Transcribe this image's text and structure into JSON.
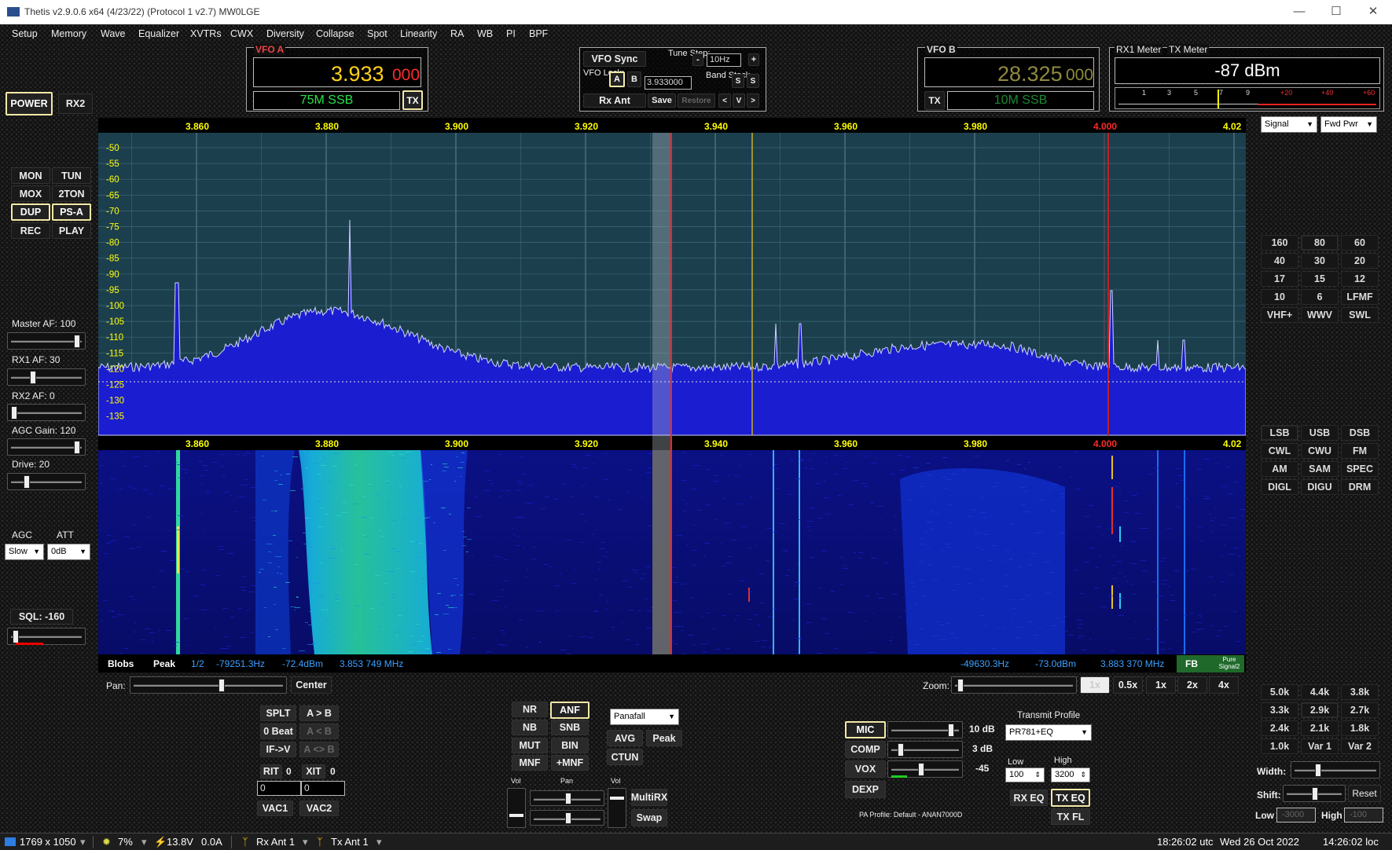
{
  "window": {
    "title": "Thetis v2.9.0.6 x64 (4/23/22) (Protocol 1 v2.7) MW0LGE",
    "minimize": "—",
    "maximize": "☐",
    "close": "✕"
  },
  "menu": [
    "Setup",
    "Memory",
    "Wave",
    "Equalizer",
    "XVTRs",
    "CWX",
    "Diversity",
    "Collapse",
    "Spot",
    "Linearity",
    "RA",
    "WB",
    "PI",
    "BPF"
  ],
  "power": {
    "power": "POWER",
    "rx2": "RX2"
  },
  "transport": {
    "mon": "MON",
    "tun": "TUN",
    "mox": "MOX",
    "twoton": "2TON",
    "dup": "DUP",
    "psa": "PS-A",
    "rec": "REC",
    "play": "PLAY"
  },
  "vfoa": {
    "label": "VFO A",
    "freq_main": "3.933",
    "freq_sub": "000",
    "band": "75M SSB",
    "tx": "TX"
  },
  "vfosync": {
    "title": "VFO Sync",
    "tune_step_label": "Tune Step:",
    "minus": "-",
    "step": "10Hz",
    "plus": "+",
    "vfo_lock_label": "VFO Lock:",
    "a": "A",
    "b": "B",
    "freq": "3.933000",
    "band_stack_label": "Band Stack",
    "s1": "S",
    "s2": "S",
    "rx_ant": "Rx Ant",
    "save": "Save",
    "restore": "Restore",
    "prev": "<",
    "v": "V",
    "next": ">"
  },
  "vfob": {
    "label": "VFO B",
    "freq_main": "28.325",
    "freq_sub": "000",
    "tx": "TX",
    "band": "10M SSB"
  },
  "meter": {
    "rx1_label": "RX1 Meter",
    "tx_label": "TX Meter",
    "reading": "-87 dBm",
    "scale": [
      "1",
      "3",
      "5",
      "7",
      "9",
      "+20",
      "+40",
      "+60"
    ],
    "rx_mode": "Signal",
    "tx_mode": "Fwd Pwr"
  },
  "spectrum": {
    "freq_ticks": [
      "3.860",
      "3.880",
      "3.900",
      "3.920",
      "3.940",
      "3.960",
      "3.980",
      "4.000",
      "4.02"
    ],
    "db_ticks": [
      "-50",
      "-55",
      "-60",
      "-65",
      "-70",
      "-75",
      "-80",
      "-85",
      "-90",
      "-95",
      "-100",
      "-105",
      "-110",
      "-115",
      "-120",
      "-125",
      "-130",
      "-135"
    ],
    "blobs": "Blobs",
    "peak": "Peak",
    "page": "1/2",
    "cursor_hz": "-79251.3Hz",
    "cursor_dbm": "-72.4dBm",
    "cursor_mhz": "3.853 749 MHz",
    "peak_hz": "-49630.3Hz",
    "peak_dbm": "-73.0dBm",
    "peak_mhz": "3.883 370 MHz",
    "fb": "FB",
    "pure_signal": "Pure Signal2"
  },
  "colors": {
    "accent_yellow": "#ffff00",
    "vfo_a_freq": "#ffd21a",
    "vfo_a_sub": "#ff2a2a",
    "band_green": "#29e04a",
    "pan_bg": "#1a3a4a",
    "pan_fill": "#1320c8",
    "highlight_border": "#f3e9a6"
  },
  "left": {
    "master_af": "Master AF:  100",
    "rx1_af": "RX1 AF:  30",
    "rx2_af": "RX2 AF:  0",
    "agc_gain": "AGC Gain:  120",
    "drive": "Drive:  20",
    "agc": "AGC",
    "att": "ATT",
    "agc_val": "Slow",
    "att_val": "0dB",
    "sql": "SQL:  -160",
    "levels": {
      "master_af": 1.0,
      "rx1_af": 0.3,
      "rx2_af": 0.0,
      "agc_gain": 1.0,
      "drive": 0.2,
      "sql": 0.02
    }
  },
  "pan": {
    "label": "Pan:",
    "center": "Center",
    "level": 0.6
  },
  "zoom": {
    "label": "Zoom:",
    "z1": "1x",
    "z05": "0.5x",
    "z1b": "1x",
    "z2": "2x",
    "z4": "4x",
    "level": 0.02
  },
  "bands": [
    "160",
    "80",
    "60",
    "40",
    "30",
    "20",
    "17",
    "15",
    "12",
    "10",
    "6",
    "LFMF",
    "VHF+",
    "WWV",
    "SWL"
  ],
  "modes": [
    "LSB",
    "USB",
    "DSB",
    "CWL",
    "CWU",
    "FM",
    "AM",
    "SAM",
    "SPEC",
    "DIGL",
    "DIGU",
    "DRM"
  ],
  "filters": [
    "5.0k",
    "4.4k",
    "3.8k",
    "3.3k",
    "2.9k",
    "2.7k",
    "2.4k",
    "2.1k",
    "1.8k",
    "1.0k",
    "Var 1",
    "Var 2"
  ],
  "filter_ctrl": {
    "width": "Width:",
    "shift": "Shift:",
    "reset": "Reset",
    "low": "Low",
    "low_val": "-3000",
    "high": "High",
    "high_val": "-100"
  },
  "split": {
    "splt": "SPLT",
    "atob": "A > B",
    "zbeat": "0 Beat",
    "btoa": "A < B",
    "ifv": "IF->V",
    "swap": "A <> B",
    "rit": "RIT",
    "rit_state": "0",
    "xit": "XIT",
    "xit_state": "0",
    "rit_val": "0",
    "xit_val": "0",
    "vac1": "VAC1",
    "vac2": "VAC2"
  },
  "dsp": {
    "nr": "NR",
    "anf": "ANF",
    "nb": "NB",
    "snb": "SNB",
    "mut": "MUT",
    "bin": "BIN",
    "mnf": "MNF",
    "pmnf": "+MNF",
    "display_mode": "Panafall",
    "avg": "AVG",
    "peak": "Peak",
    "ctun": "CTUN",
    "vol": "Vol",
    "pan": "Pan",
    "vol2": "Vol",
    "multirx": "MultiRX",
    "swap": "Swap"
  },
  "tx": {
    "mic": "MIC",
    "mic_val": "10 dB",
    "comp": "COMP",
    "comp_val": "3 dB",
    "vox": "VOX",
    "vox_val": "-45",
    "dexp": "DEXP",
    "pa_profile": "PA Profile: Default - ANAN7000D",
    "profile_label": "Transmit Profile",
    "profile": "PR781+EQ",
    "low_label": "Low",
    "low": "100",
    "high_label": "High",
    "high": "3200",
    "rxeq": "RX EQ",
    "txeq": "TX EQ",
    "txfl": "TX FL",
    "levels": {
      "mic": 0.95,
      "comp": 0.1,
      "vox": 0.45
    }
  },
  "statusbar": {
    "resolution": "1769 x 1050",
    "cpu": "7%",
    "voltage": "13.8V",
    "current": "0.0A",
    "rx_ant": "Rx Ant 1",
    "tx_ant": "Tx Ant 1",
    "utc": "18:26:02 utc",
    "date": "Wed 26 Oct 2022",
    "local": "14:26:02 loc"
  }
}
